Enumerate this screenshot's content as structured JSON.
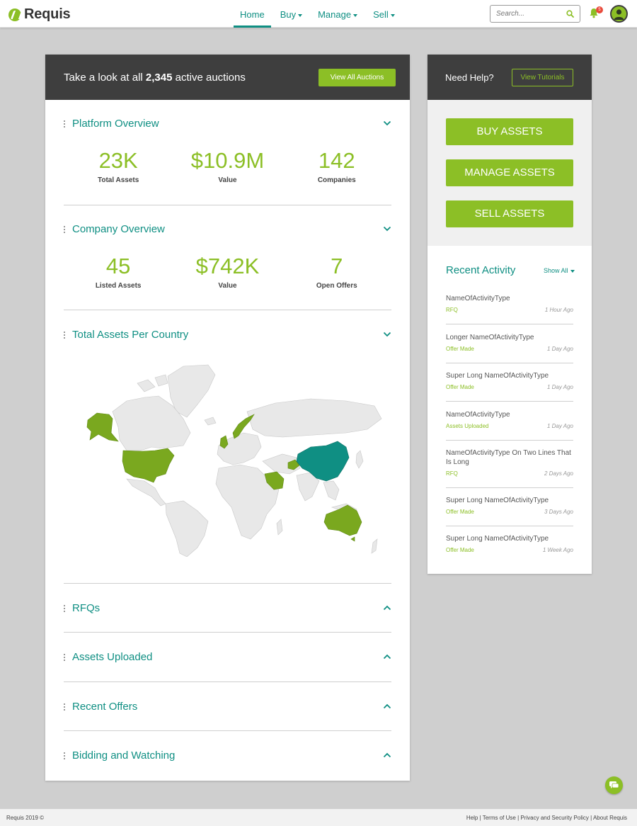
{
  "brand": {
    "name": "Requis"
  },
  "nav": [
    {
      "label": "Home",
      "active": true,
      "caret": false
    },
    {
      "label": "Buy",
      "active": false,
      "caret": true
    },
    {
      "label": "Manage",
      "active": false,
      "caret": true
    },
    {
      "label": "Sell",
      "active": false,
      "caret": true
    }
  ],
  "search": {
    "placeholder": "Search..."
  },
  "notifications": {
    "count": "5"
  },
  "colors": {
    "teal": "#0f8f83",
    "green": "#8cbf26",
    "dark": "#3e3e3e"
  },
  "main": {
    "banner": {
      "prefix": "Take a look at all ",
      "count": "2,345",
      "suffix": " active auctions",
      "button": "View All Auctions"
    },
    "platform_overview": {
      "title": "Platform Overview",
      "stats": [
        {
          "value": "23K",
          "label": "Total Assets"
        },
        {
          "value": "$10.9M",
          "label": "Value"
        },
        {
          "value": "142",
          "label": "Companies"
        }
      ]
    },
    "company_overview": {
      "title": "Company Overview",
      "stats": [
        {
          "value": "45",
          "label": "Listed Assets"
        },
        {
          "value": "$742K",
          "label": "Value"
        },
        {
          "value": "7",
          "label": "Open Offers"
        }
      ]
    },
    "map_section": {
      "title": "Total Assets Per Country",
      "highlighted_green": [
        "United States",
        "Alaska",
        "United Kingdom",
        "Norway",
        "Saudi Arabia",
        "Afghanistan",
        "Australia"
      ],
      "highlighted_teal": [
        "China"
      ]
    },
    "collapsed_sections": [
      "RFQs",
      "Assets Uploaded",
      "Recent Offers",
      "Bidding and Watching"
    ]
  },
  "sidebar": {
    "help_text": "Need Help?",
    "tutorials_button": "View Tutorials",
    "buttons": [
      "BUY ASSETS",
      "MANAGE ASSETS",
      "SELL ASSETS"
    ],
    "recent_activity": {
      "title": "Recent Activity",
      "show_all": "Show All",
      "items": [
        {
          "name": "NameOfActivityType",
          "type": "RFQ",
          "time": "1 Hour Ago",
          "type_color": "#8cbf26"
        },
        {
          "name": "Longer NameOfActivityType",
          "type": "Offer Made",
          "time": "1 Day Ago",
          "type_color": "#8cbf26"
        },
        {
          "name": "Super Long NameOfActivityType",
          "type": "Offer Made",
          "time": "1 Day Ago",
          "type_color": "#8cbf26"
        },
        {
          "name": "NameOfActivityType",
          "type": "Assets Uploaded",
          "time": "1 Day Ago",
          "type_color": "#8cbf26"
        },
        {
          "name": "NameOfActivityType On Two Lines That Is Long",
          "type": "RFQ",
          "time": "2 Days Ago",
          "type_color": "#8cbf26"
        },
        {
          "name": "Super Long NameOfActivityType",
          "type": "Offer Made",
          "time": "3 Days Ago",
          "type_color": "#8cbf26"
        },
        {
          "name": "Super Long NameOfActivityType",
          "type": "Offer Made",
          "time": "1 Week Ago",
          "type_color": "#8cbf26"
        }
      ]
    }
  },
  "footer": {
    "copyright": "Requis 2019 ©",
    "links": [
      "Help",
      "Terms of Use",
      "Privacy and Security Policy",
      "About Requis"
    ]
  }
}
